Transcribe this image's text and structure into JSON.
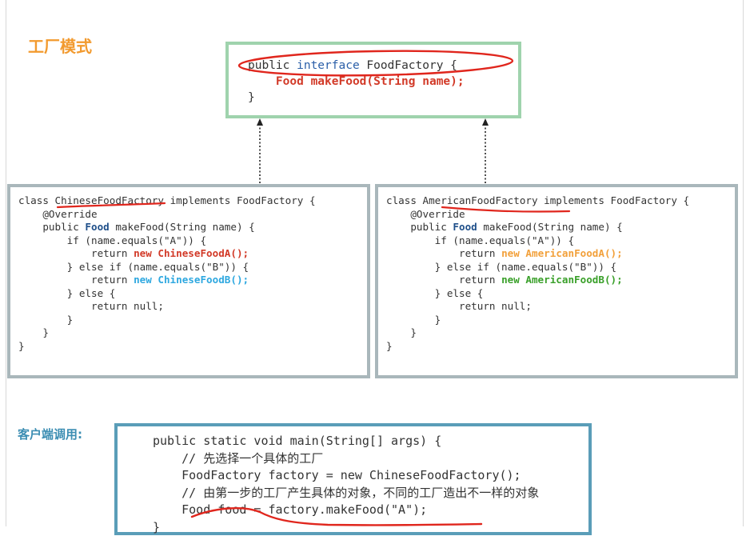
{
  "title": "工厂模式",
  "interface_code": {
    "line1_a": "public ",
    "line1_kw": "interface",
    "line1_b": " FoodFactory {",
    "line2": "Food makeFood(String name);",
    "line3": "}"
  },
  "chinese_factory": {
    "l1_a": "class ",
    "l1_name": "ChineseFoodFactory",
    "l1_b": " implements FoodFactory {",
    "l3": "    @Override",
    "l4_a": "    public ",
    "l4_food": "Food",
    "l4_b": " makeFood(String name) {",
    "l5": "        if (name.equals(\"A\")) {",
    "l6_a": "            return ",
    "l6_b": "new ChineseFoodA();",
    "l7": "        } else if (name.equals(\"B\")) {",
    "l8_a": "            return ",
    "l8_b": "new ChineseFoodB();",
    "l9": "        } else {",
    "l10": "            return null;",
    "l11": "        }",
    "l12": "    }",
    "l13": "}"
  },
  "american_factory": {
    "l1_a": "class ",
    "l1_name": "AmericanFoodFactory",
    "l1_b": " implements FoodFactory {",
    "l3": "    @Override",
    "l4_a": "    public ",
    "l4_food": "Food",
    "l4_b": " makeFood(String name) {",
    "l5": "        if (name.equals(\"A\")) {",
    "l6_a": "            return ",
    "l6_new": "new ",
    "l6_b": "AmericanFoodA();",
    "l7": "        } else if (name.equals(\"B\")) {",
    "l8_a": "            return ",
    "l8_b": "new AmericanFoodB();",
    "l9": "        } else {",
    "l10": "            return null;",
    "l11": "        }",
    "l12": "    }",
    "l13": "}"
  },
  "client_label": "客户端调用:",
  "client_code": {
    "l1": "public static void main(String[] args) {",
    "l2": "    // 先选择一个具体的工厂",
    "l3": "    FoodFactory factory = new ChineseFoodFactory();",
    "l4": "    // 由第一步的工厂产生具体的对象，不同的工厂造出不一样的对象",
    "l5": "    Food food = factory.makeFood(\"A\");",
    "l6": "}"
  },
  "colors": {
    "title": "#f29a2e",
    "interface_border": "#9fd3ad",
    "factory_border": "#a9b7bb",
    "client_border": "#5a9db8",
    "annotation_red": "#e0261d"
  }
}
